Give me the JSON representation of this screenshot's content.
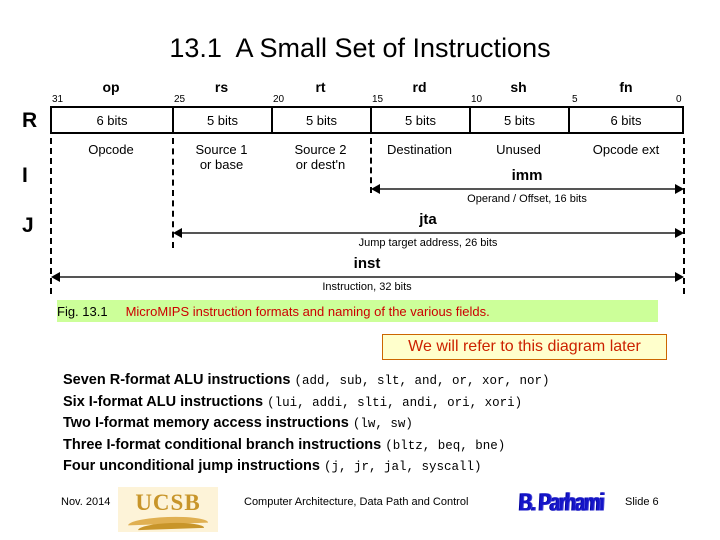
{
  "slide": {
    "title": "13.1  A Small Set of Instructions"
  },
  "diagram": {
    "row_letters": [
      "R",
      "I",
      "J"
    ],
    "field_names": [
      "op",
      "rs",
      "rt",
      "rd",
      "sh",
      "fn"
    ],
    "bit_numbers": [
      "31",
      "25",
      "20",
      "15",
      "10",
      "5",
      "0"
    ],
    "field_widths": [
      "6 bits",
      "5 bits",
      "5 bits",
      "5 bits",
      "5 bits",
      "6 bits"
    ],
    "field_descriptions": [
      "Opcode",
      "Source 1\nor base",
      "Source 2\nor dest'n",
      "Destination",
      "Unused",
      "Opcode ext"
    ],
    "spans": [
      {
        "label": "imm",
        "sublabel": "Operand / Offset, 16 bits"
      },
      {
        "label": "jta",
        "sublabel": "Jump target address, 26 bits"
      },
      {
        "label": "inst",
        "sublabel": "Instruction, 32 bits"
      }
    ]
  },
  "caption": {
    "figure_number": "Fig. 13.1",
    "figure_text": "MicroMIPS instruction formats and naming of the various fields.",
    "background_color": "#ccff99"
  },
  "callout": {
    "text": "We will refer to this diagram later",
    "background_color": "#ffffcc",
    "border_color": "#cc6600",
    "text_color": "#cc2200"
  },
  "bullets": [
    {
      "lead": "Seven R-format ALU instructions ",
      "mono": "(add, sub, slt, and, or, xor, nor)"
    },
    {
      "lead": "Six I-format ALU instructions ",
      "mono": "(lui, addi, slti, andi, ori, xori)"
    },
    {
      "lead": "Two I-format memory access instructions ",
      "mono": "(lw, sw)"
    },
    {
      "lead": "Three I-format conditional branch instructions ",
      "mono": "(bltz, beq, bne)"
    },
    {
      "lead": "Four unconditional jump instructions ",
      "mono": "(j, jr, jal, syscall)"
    }
  ],
  "footer": {
    "date": "Nov. 2014",
    "course_title": "Computer Architecture, Data Path and Control",
    "slide_number": "Slide 6",
    "university_logo_text": "UCSB",
    "author_logo_text": "B. Parhami"
  }
}
